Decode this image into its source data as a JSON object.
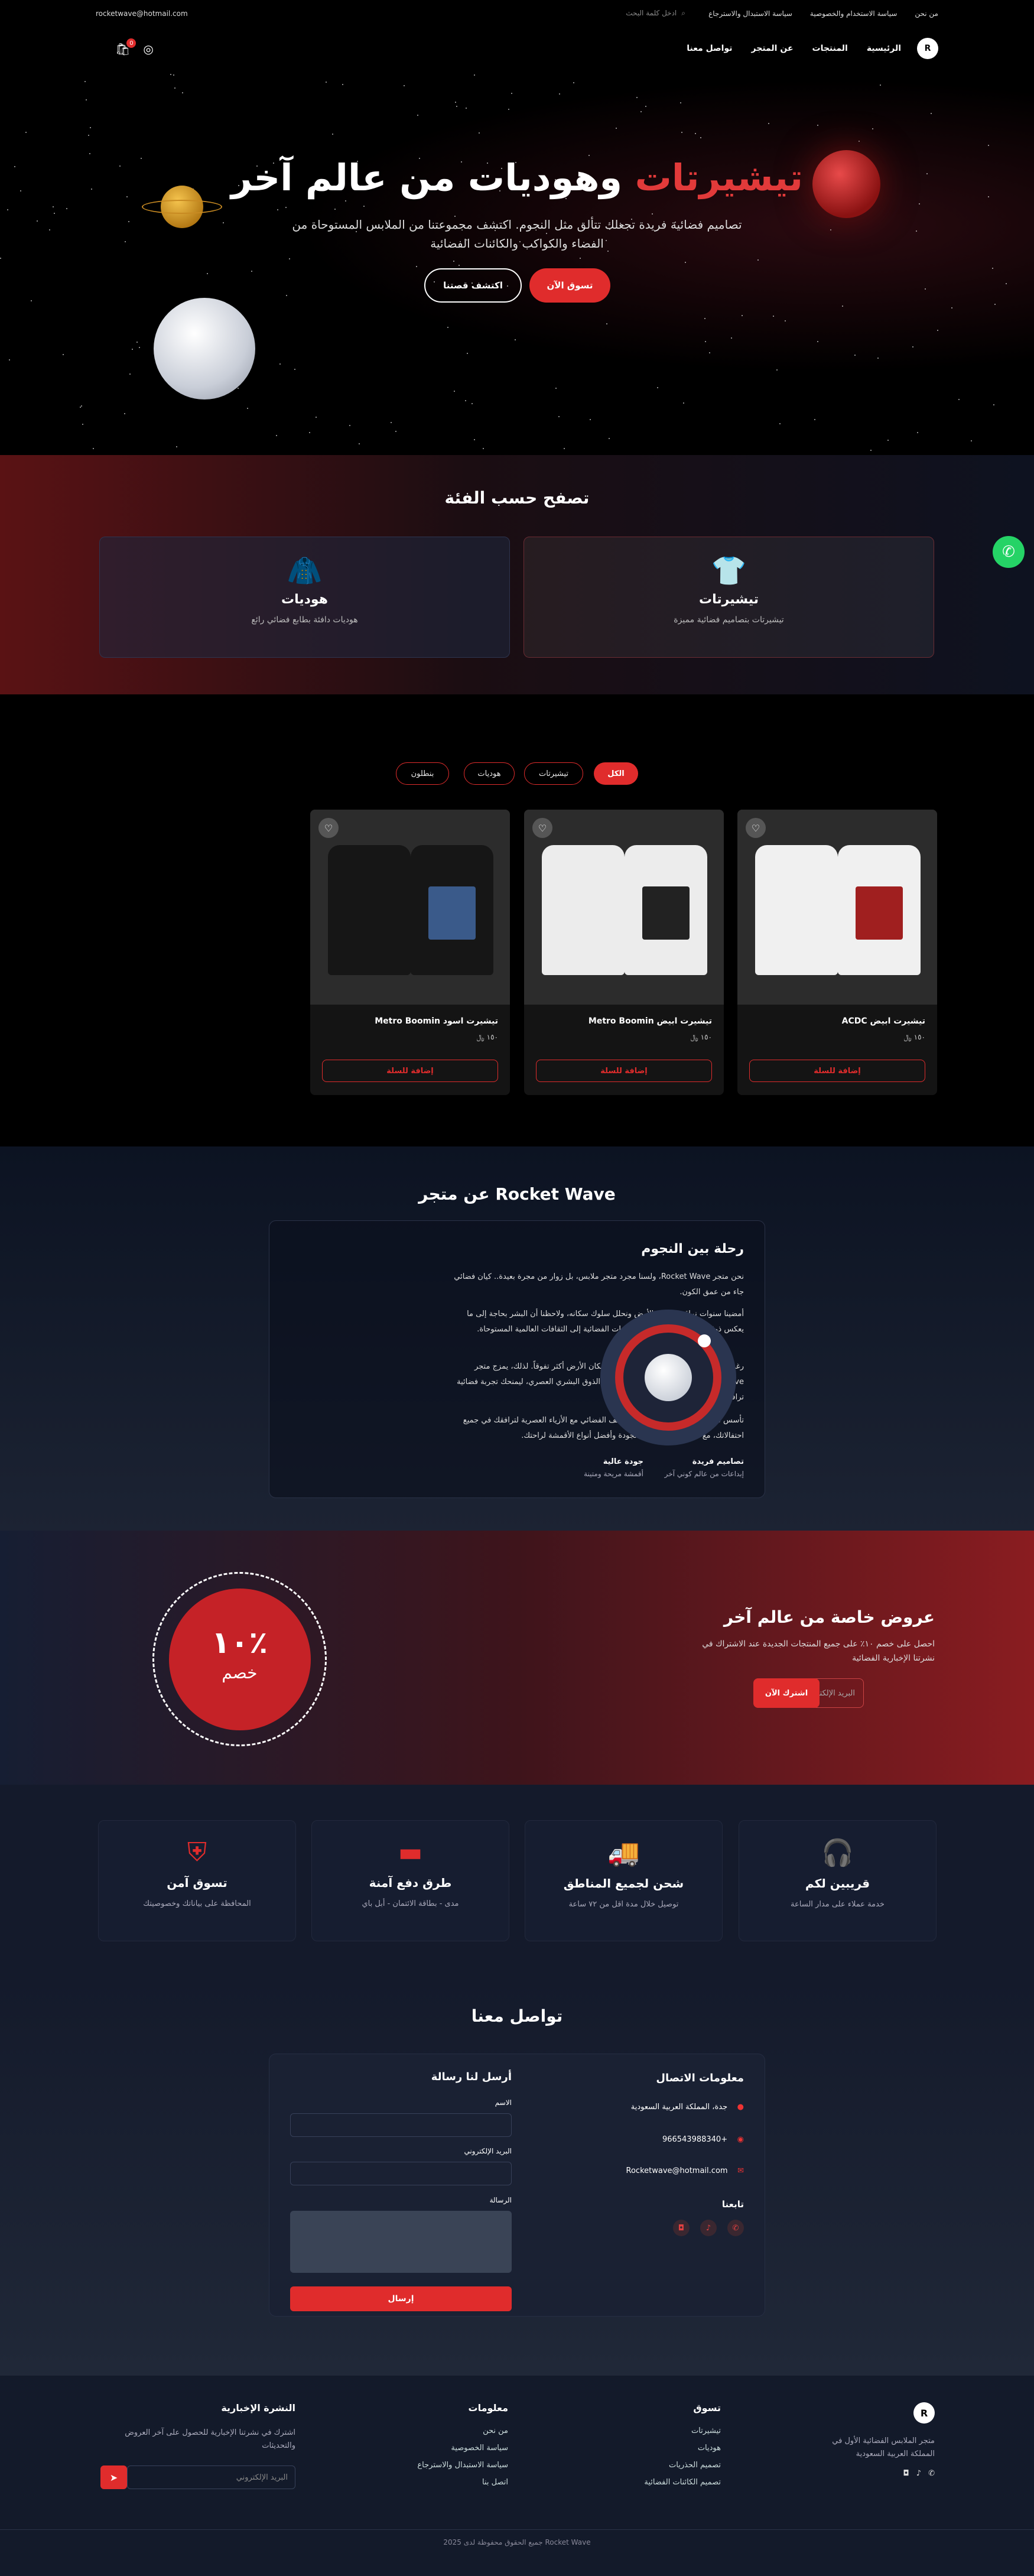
{
  "topbar": {
    "email": "rocketwave@hotmail.com",
    "links": [
      "من نحن",
      "سياسة الاستخدام والخصوصية",
      "سياسة الاستبدال والاسترجاع"
    ],
    "search_placeholder": "ادخل كلمة البحث"
  },
  "nav": {
    "logo": "R",
    "items": [
      "الرئيسية",
      "المنتجات",
      "عن المتجر",
      "تواصل معنا"
    ],
    "cart_count": "0"
  },
  "hero": {
    "title_red": "تيشيرتات",
    "title_white": "وهوديات من عالم آخر",
    "subtitle": "تصاميم فضائية فريدة تجعلك تتألق مثل النجوم. اكتشف مجموعتنا من الملابس المستوحاة من الفضاء والكواكب والكائنات الفضائية",
    "shop_btn": "تسوق الآن",
    "discover_btn": "اكتشف قصتنا"
  },
  "categories": {
    "title": "تصفح حسب الفئة",
    "items": [
      {
        "icon": "tshirt-icon",
        "name": "تيشيرتات",
        "desc": "تيشيرتات بتصاميم فضائية مميزة"
      },
      {
        "icon": "hoodie-icon",
        "name": "هوديات",
        "desc": "هوديات دافئة بطابع فضائي رائع"
      }
    ]
  },
  "products": {
    "filters": [
      "الكل",
      "تيشيرتات",
      "هوديات",
      "بنطلون"
    ],
    "items": [
      {
        "name": "تيشيرت ابيض ACDC",
        "price": "١٥٠ ﷼",
        "add": "إضافة للسلة",
        "color": "#f0f0f0",
        "print": "#a01f1f"
      },
      {
        "name": "تيشيرت ابيض Metro Boomin",
        "price": "١٥٠ ﷼",
        "add": "إضافة للسلة",
        "color": "#ececec",
        "print": "#222222"
      },
      {
        "name": "تيشيرت اسود Metro Boomin",
        "price": "١٥٠ ﷼",
        "add": "إضافة للسلة",
        "color": "#161616",
        "print": "#3a5a8a"
      }
    ]
  },
  "about": {
    "title": "عن متجر Rocket Wave",
    "card_title": "رحلة بين النجوم",
    "paragraphs": [
      "نحن متجر Rocket Wave، ولسنا مجرد متجر ملابس، بل زوار من مجرة بعيدة.. كيان فضائي جاء من عمق الكون.",
      "أمضينا سنوات نراقب كوكب الأرض ونحلل سلوك سكانه، ولاحظنا أن البشر بحاجة إلى ما يعكس ذوقهم الفريد في إطار من الحقبات الفضائية إلى الثقافات العالمية المستوحاة.",
      "رغم اهتمام سكان المريخ بالأزياء، وجدنا أن سكان الأرض أكثر تفوقاً. لذلك، يمزج متجر Rocket Wave الطابع الكوني المستقبلي مع الذوق البشري العصري، ليمنحك تجربة فضائية ترافقك على الأرض.",
      "تأسس متجرنا في ٢٠٢٥ بهدف دمج الشغف الفضائي مع الأزياء العصرية لترافقك في جميع احتفالاتك، مع ضمان أعلى معايير الجودة وأفضل أنواع الأقمشة لراحتك."
    ],
    "features": [
      {
        "title": "تصاميم فريدة",
        "desc": "إبداعات من عالم كوني آخر"
      },
      {
        "title": "جودة عالية",
        "desc": "أقمشة مريحة ومتينة"
      }
    ]
  },
  "offers": {
    "title": "عروض خاصة من عالم آخر",
    "desc": "احصل على خصم ١٠٪ على جميع المنتجات الجديدة عند الاشتراك في نشرتنا الإخبارية الفضائية",
    "email_placeholder": "البريد الإلكتروني",
    "subscribe": "اشترك الآن",
    "badge_value": "١٠٪",
    "badge_label": "خصم"
  },
  "features": [
    {
      "icon": "headset-icon",
      "title": "قريبين لكم",
      "desc": "خدمة عملاء على مدار الساعة"
    },
    {
      "icon": "truck-icon",
      "title": "شحن لجميع المناطق",
      "desc": "توصيل خلال مدة اقل من ٧٢ ساعة"
    },
    {
      "icon": "card-icon",
      "title": "طرق دفع آمنة",
      "desc": "مدى - بطاقة الائتمان - أبل باي"
    },
    {
      "icon": "shield-icon",
      "title": "تسوق آمن",
      "desc": "المحافظة على بياناتك وخصوصيتك"
    }
  ],
  "contact": {
    "title": "تواصل معنا",
    "info_title": "معلومات الاتصال",
    "address": "جدة، المملكة العربية السعودية",
    "phone": "+966543988340",
    "email": "Rocketwave@hotmail.com",
    "follow": "تابعنا",
    "form_title": "أرسل لنا رسالة",
    "name_label": "الاسم",
    "email_label": "البريد الإلكتروني",
    "message_label": "الرسالة",
    "send": "إرسال"
  },
  "footer": {
    "logo": "R",
    "about": "متجر الملابس الفضائية الأول في المملكة العربية السعودية",
    "shop": {
      "title": "تسوق",
      "items": [
        "تيشيرتات",
        "هوديات",
        "تصميم الحذريات",
        "تصميم الكائنات الفضائية"
      ]
    },
    "info": {
      "title": "معلومات",
      "items": [
        "من نحن",
        "سياسة الخصوصية",
        "سياسة الاستبدال والاسترجاع",
        "اتصل بنا"
      ]
    },
    "newsletter": {
      "title": "النشرة الإخبارية",
      "desc": "اشترك في نشرتنا الإخبارية للحصول على آخر العروض والتحديثات",
      "placeholder": "البريد الإلكتروني"
    },
    "copyright": "2025 جميع الحقوق محفوظة لدى Rocket Wave"
  }
}
